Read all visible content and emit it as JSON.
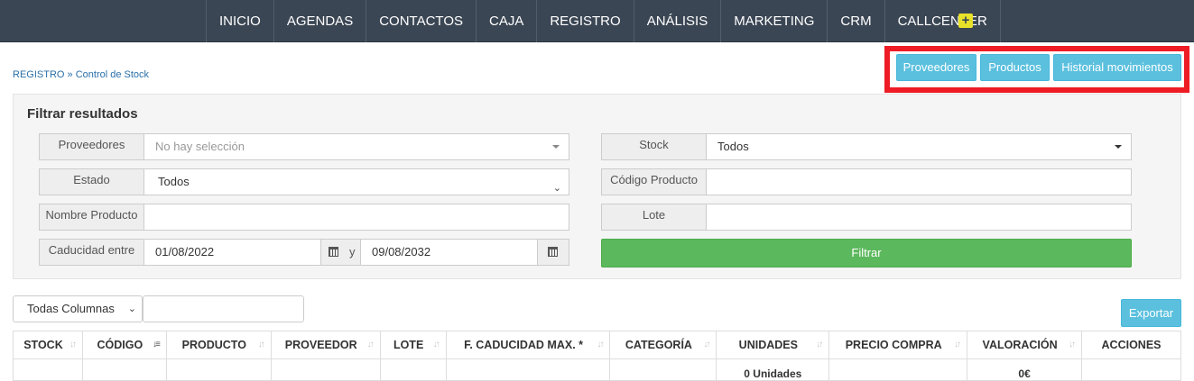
{
  "nav": {
    "items": [
      "INICIO",
      "AGENDAS",
      "CONTACTOS",
      "CAJA",
      "REGISTRO",
      "ANÁLISIS",
      "MARKETING",
      "CRM",
      "CALLCENTER"
    ],
    "plus": "+"
  },
  "breadcrumb": {
    "root": "REGISTRO",
    "sep": "»",
    "current": "Control de Stock"
  },
  "top_buttons": {
    "proveedores": "Proveedores",
    "productos": "Productos",
    "historial": "Historial movimientos"
  },
  "filter": {
    "title": "Filtrar resultados",
    "proveedores_label": "Proveedores",
    "proveedores_placeholder": "No hay selección",
    "estado_label": "Estado",
    "estado_value": "Todos",
    "nombre_label": "Nombre Producto",
    "nombre_value": "",
    "caducidad_label": "Caducidad entre",
    "caducidad_from": "01/08/2022",
    "caducidad_and": "y",
    "caducidad_to": "09/08/2032",
    "stock_label": "Stock",
    "stock_value": "Todos",
    "codigo_label": "Código Producto",
    "codigo_value": "",
    "lote_label": "Lote",
    "lote_value": "",
    "submit": "Filtrar"
  },
  "table_controls": {
    "column_select": "Todas Columnas",
    "search_value": "",
    "export": "Exportar"
  },
  "table": {
    "headers": [
      "STOCK",
      "CÓDIGO",
      "PRODUCTO",
      "PROVEEDOR",
      "LOTE",
      "F. CADUCIDAD MAX. *",
      "CATEGORÍA",
      "UNIDADES",
      "PRECIO COMPRA",
      "VALORACIÓN",
      "ACCIONES"
    ],
    "footer_units": "0 Unidades",
    "footer_valuation": "0€"
  },
  "colors": {
    "nav_bg": "#3b4654",
    "info": "#5bc0de",
    "success": "#5cb85c",
    "highlight": "#ee1c25",
    "link": "#2a6fa8"
  }
}
